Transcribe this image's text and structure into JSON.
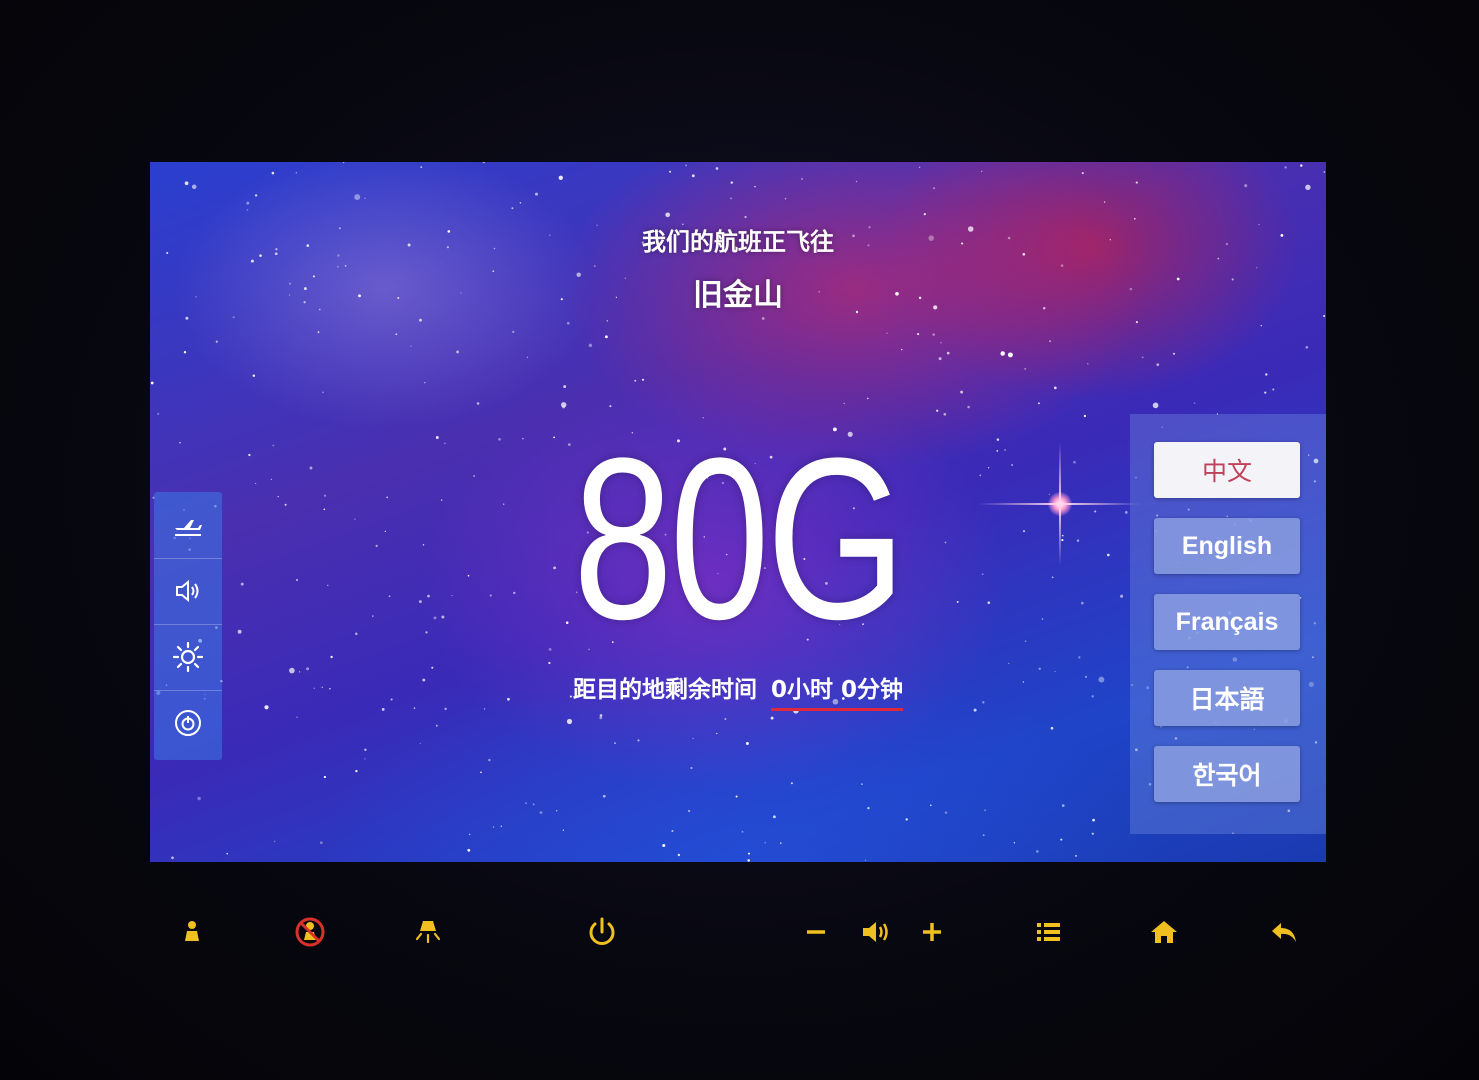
{
  "flight": {
    "heading": "我们的航班正飞往",
    "destination": "旧金山",
    "flight_number": "80G"
  },
  "remaining": {
    "label": "距目的地剩余时间",
    "time": "0小时 0分钟"
  },
  "side_menu": {
    "items": [
      {
        "icon": "airplane-icon"
      },
      {
        "icon": "volume-icon"
      },
      {
        "icon": "brightness-icon"
      },
      {
        "icon": "power-icon"
      }
    ]
  },
  "languages": {
    "selected": "中文",
    "items": [
      {
        "label": "中文"
      },
      {
        "label": "English"
      },
      {
        "label": "Français"
      },
      {
        "label": "日本語"
      },
      {
        "label": "한국어"
      }
    ]
  },
  "hardware_buttons": [
    {
      "icon": "attendant-call-icon"
    },
    {
      "icon": "attendant-call-cancel-icon"
    },
    {
      "icon": "reading-light-icon"
    },
    {
      "icon": "power-icon"
    },
    {
      "icon": "volume-down-icon"
    },
    {
      "icon": "speaker-icon"
    },
    {
      "icon": "volume-up-icon"
    },
    {
      "icon": "menu-list-icon"
    },
    {
      "icon": "home-icon"
    },
    {
      "icon": "back-icon"
    }
  ],
  "colors": {
    "hardware_icon": "#f0c020",
    "accent_underline": "#e0283a",
    "selected_language_text": "#c0415a"
  }
}
